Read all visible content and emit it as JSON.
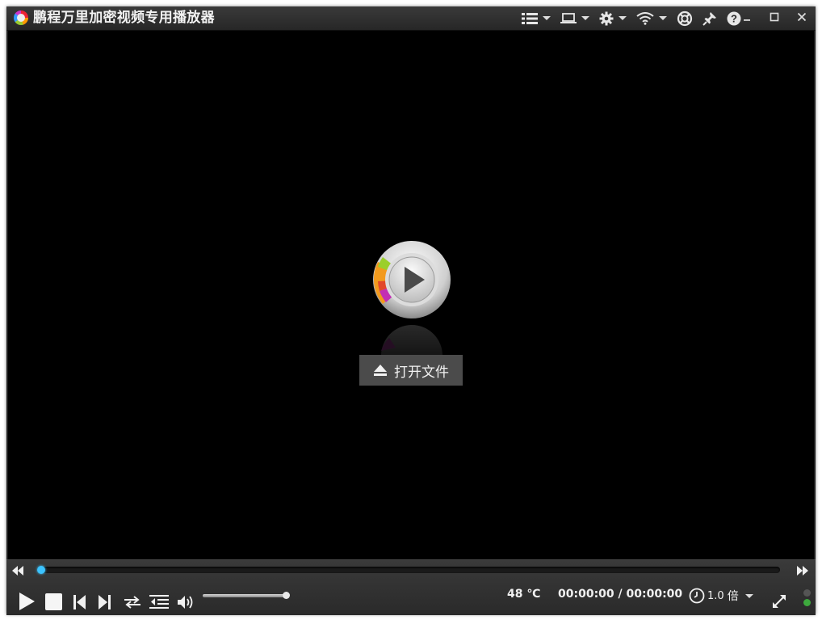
{
  "window": {
    "title": "鹏程万里加密视频专用播放器",
    "min_label": "_",
    "max_label": "□",
    "close_label": "✕"
  },
  "toolbar": {
    "icons": [
      "playlist-icon",
      "screen-icon",
      "settings-icon",
      "wifi-icon",
      "help-ring-icon",
      "pin-icon",
      "help-icon"
    ]
  },
  "main": {
    "open_file_label": "打开文件"
  },
  "controls": {
    "progress": 0,
    "volume": 1.0,
    "temperature": "48 ℃",
    "time": "00:00:00 / 00:00:00",
    "speed_value": "1.0",
    "speed_unit": "倍"
  },
  "colors": {
    "accent": "#3cc3ff",
    "status_led": "#3da93d"
  }
}
